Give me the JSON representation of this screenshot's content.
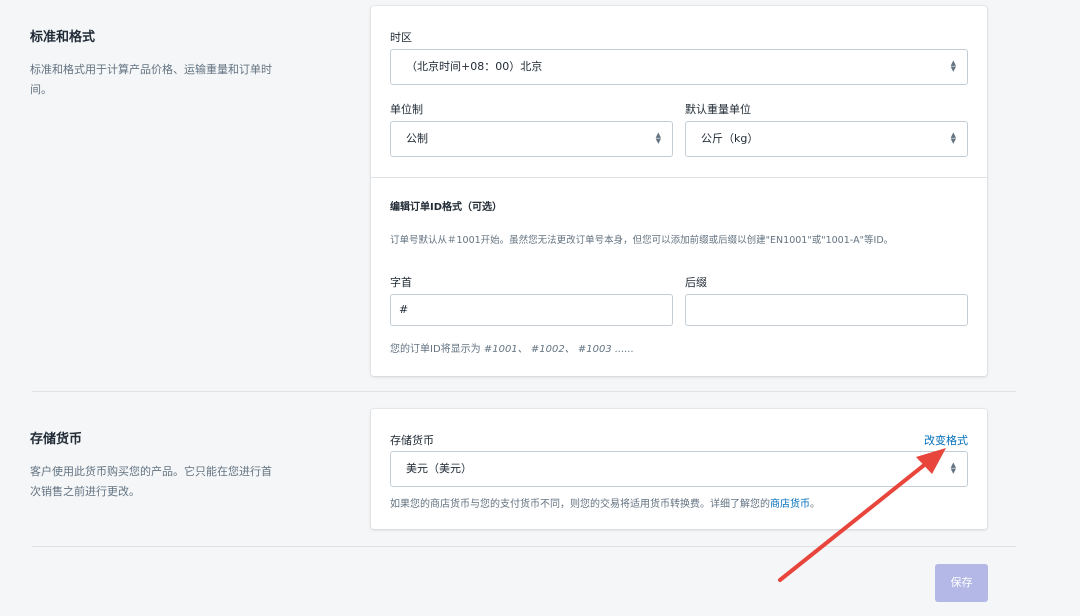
{
  "standards": {
    "title": "标准和格式",
    "description": "标准和格式用于计算产品价格、运输重量和订单时间。",
    "timezone": {
      "label": "时区",
      "value": "（北京时间+08：00）北京"
    },
    "unit_system": {
      "label": "单位制",
      "value": "公制"
    },
    "weight_unit": {
      "label": "默认重量单位",
      "value": "公斤（kg）"
    }
  },
  "order_id": {
    "title": "编辑订单ID格式（可选）",
    "description": "订单号默认从＃1001开始。虽然您无法更改订单号本身，但您可以添加前缀或后缀以创建\"EN1001\"或\"1001-A\"等ID。",
    "prefix": {
      "label": "字首",
      "value": "#"
    },
    "suffix": {
      "label": "后缀",
      "value": ""
    },
    "preview_prefix": "您的订单ID将显示为",
    "preview_values": "#1001、 #1002、 #1003 ......"
  },
  "currency": {
    "title": "存储货币",
    "description": "客户使用此货币购买您的产品。它只能在您进行首次销售之前进行更改。",
    "label": "存储货币",
    "change_link": "改变格式",
    "value": "美元（美元）",
    "note_prefix": "如果您的商店货币与您的支付货币不同，则您的交易将适用货币转换费。详细了解您的",
    "note_link": "商店货币",
    "note_suffix": "。"
  },
  "actions": {
    "save_label": "保存"
  },
  "colors": {
    "background": "#f4f6f8",
    "link": "#006fbb",
    "save_button": "#b3b8e6",
    "annotation_arrow": "#e8453c"
  },
  "icons": {
    "select_arrows": "select-arrows-icon"
  }
}
